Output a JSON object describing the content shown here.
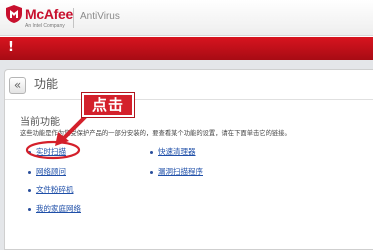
{
  "header": {
    "brand": "McAfee",
    "brand_sub": "An Intel Company",
    "product": "AntiVirus"
  },
  "alert": {
    "mark": "!"
  },
  "panel": {
    "back_glyph": "«",
    "title": "功能"
  },
  "section": {
    "heading": "当前功能",
    "description": "这些功能是作为您受保护产品的一部分安装的，要查看某个功能的设置，请在下面单击它的链接。"
  },
  "links": {
    "col1": [
      "实时扫描",
      "网络顾问",
      "文件粉碎机",
      "我的家庭网络"
    ],
    "col2": [
      "快速清理器",
      "漏洞扫描程序"
    ]
  },
  "annotation": {
    "callout": "点击"
  },
  "colors": {
    "brand_red": "#c8102e",
    "alert_red": "#d8141f",
    "link_blue": "#1f4fa8",
    "annotation_red": "#d4202b"
  }
}
